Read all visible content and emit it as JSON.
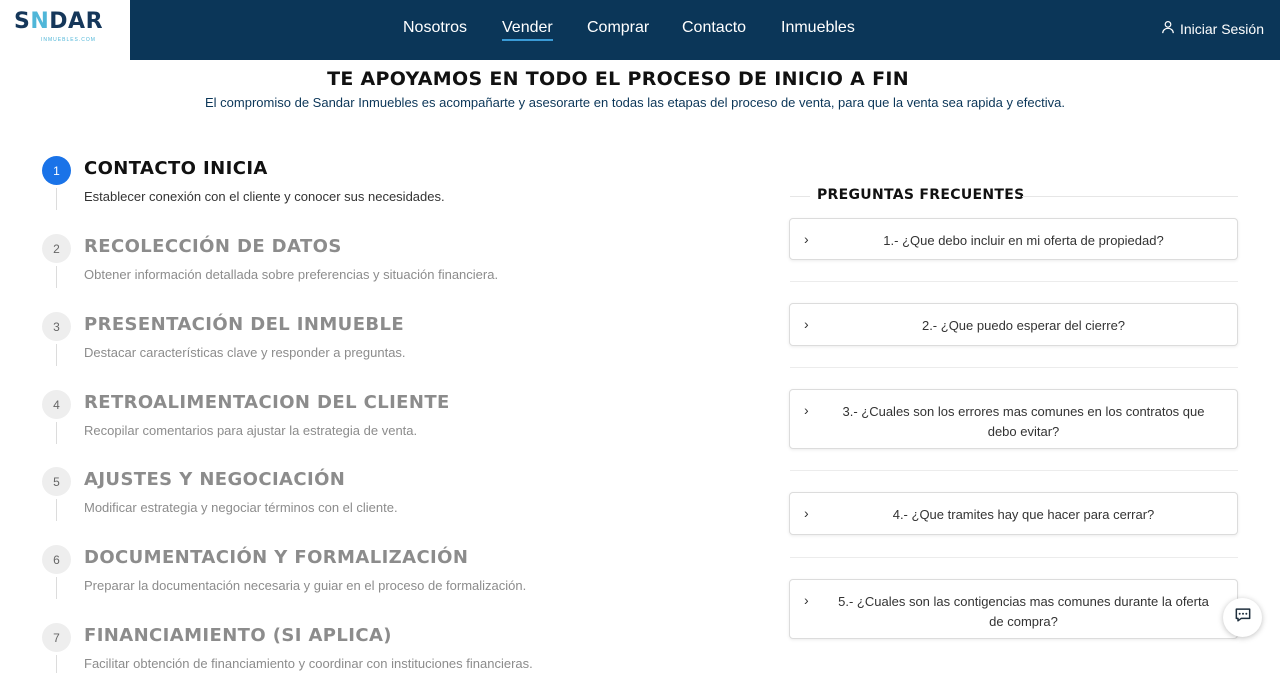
{
  "header": {
    "logo_text_left": "S",
    "logo_text_accent": "N",
    "logo_text_right": "DAR",
    "logo_sub": "INMUEBLES.COM",
    "nav": [
      {
        "label": "Nosotros"
      },
      {
        "label": "Vender",
        "active": true
      },
      {
        "label": "Comprar"
      },
      {
        "label": "Contacto"
      },
      {
        "label": "Inmuebles"
      }
    ],
    "login_label": "Iniciar Sesión",
    "login_icon": "user-icon",
    "colors": {
      "bar": "#0b3658",
      "accent": "#4fb6d8",
      "active_underline": "#3a9bd6"
    }
  },
  "intro": {
    "title": "TE APOYAMOS EN TODO EL PROCESO DE INICIO A FIN",
    "subtitle": "El compromiso de Sandar Inmuebles es acompañarte y asesorarte en todas las etapas del proceso de venta, para que la venta sea rapida y efectiva."
  },
  "steps": [
    {
      "number": "1",
      "title": "CONTACTO INICIA",
      "desc": "Establecer conexión con el cliente y conocer sus necesidades.",
      "active": true
    },
    {
      "number": "2",
      "title": "RECOLECCIÓN DE DATOS",
      "desc": "Obtener información detallada sobre preferencias y situación financiera."
    },
    {
      "number": "3",
      "title": "PRESENTACIÓN DEL INMUEBLE",
      "desc": "Destacar características clave y responder a preguntas."
    },
    {
      "number": "4",
      "title": "RETROALIMENTACION DEL CLIENTE",
      "desc": "Recopilar comentarios para ajustar la estrategia de venta."
    },
    {
      "number": "5",
      "title": "AJUSTES Y NEGOCIACIÓN",
      "desc": "Modificar estrategia y negociar términos con el cliente."
    },
    {
      "number": "6",
      "title": "DOCUMENTACIÓN Y FORMALIZACIÓN",
      "desc": "Preparar la documentación necesaria y guiar en el proceso de formalización."
    },
    {
      "number": "7",
      "title": "FINANCIAMIENTO (SI APLICA)",
      "desc": "Facilitar obtención de financiamiento y coordinar con instituciones financieras."
    }
  ],
  "faq": {
    "title": "PREGUNTAS FRECUENTES",
    "chevron": "›",
    "items": [
      {
        "question": "1.- ¿Que debo incluir en mi oferta de propiedad?"
      },
      {
        "question": "2.- ¿Que puedo esperar del cierre?"
      },
      {
        "question": "3.- ¿Cuales son los errores mas comunes en los contratos que debo evitar?"
      },
      {
        "question": "4.- ¿Que tramites hay que hacer para cerrar?"
      },
      {
        "question": "5.- ¿Cuales son las contigencias mas comunes durante la oferta de compra?"
      }
    ]
  },
  "chat": {
    "icon": "chat-icon"
  }
}
